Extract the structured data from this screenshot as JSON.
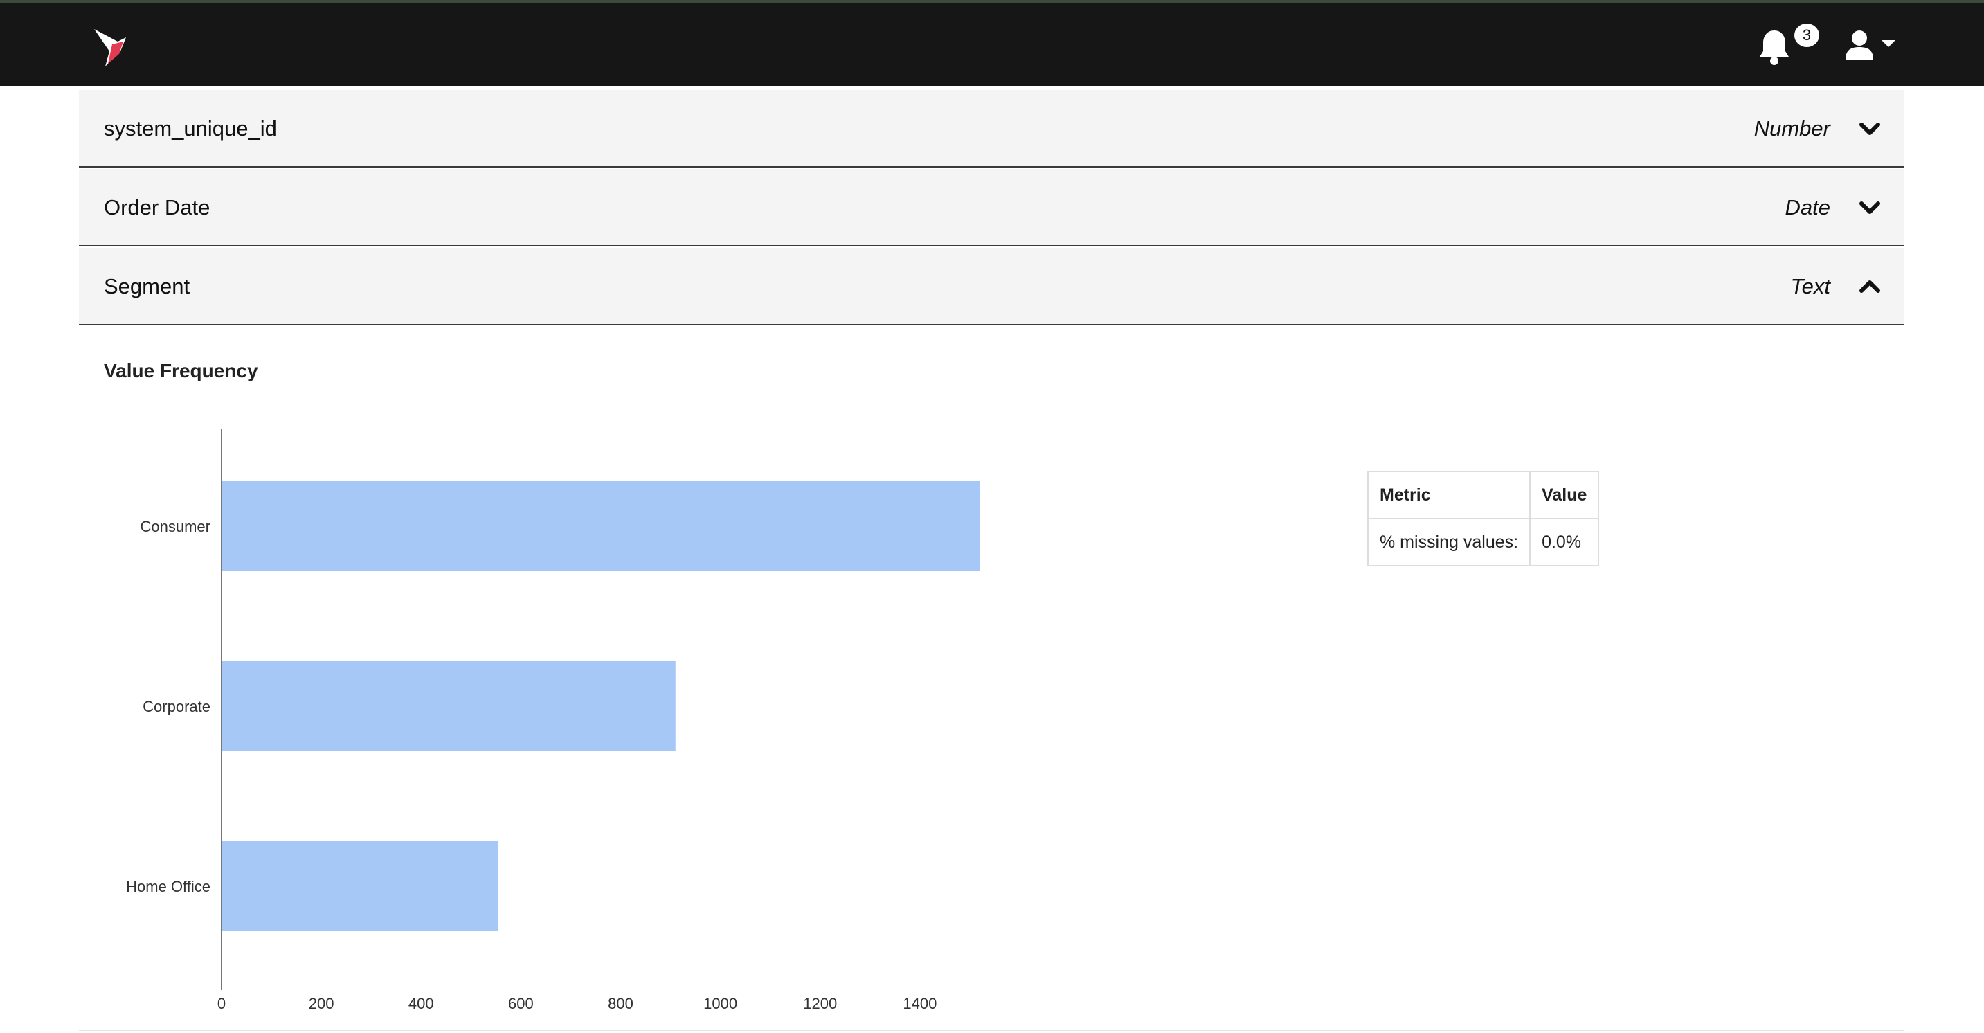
{
  "header": {
    "logo_icon": "hummingbird-logo",
    "notifications": {
      "icon": "bell-icon",
      "count": "3"
    },
    "user_menu": {
      "icon": "user-icon",
      "caret_icon": "caret-down-icon"
    }
  },
  "columns": [
    {
      "name": "system_unique_id",
      "type": "Number",
      "expanded": false
    },
    {
      "name": "Order Date",
      "type": "Date",
      "expanded": false
    },
    {
      "name": "Segment",
      "type": "Text",
      "expanded": true
    }
  ],
  "details": {
    "value_frequency_title": "Value Frequency",
    "metrics_table": {
      "headers": [
        "Metric",
        "Value"
      ],
      "rows": [
        [
          "% missing values:",
          "0.0%"
        ]
      ]
    }
  },
  "chart_data": {
    "type": "bar",
    "orientation": "horizontal",
    "categories": [
      "Consumer",
      "Corporate",
      "Home Office"
    ],
    "values": [
      1520,
      910,
      555
    ],
    "xlim": [
      0,
      1600
    ],
    "xticks": [
      0,
      200,
      400,
      600,
      800,
      1000,
      1200,
      1400,
      1600
    ],
    "bar_color": "#a5c8f7",
    "grid": false,
    "title": "",
    "xlabel": "",
    "ylabel": ""
  }
}
